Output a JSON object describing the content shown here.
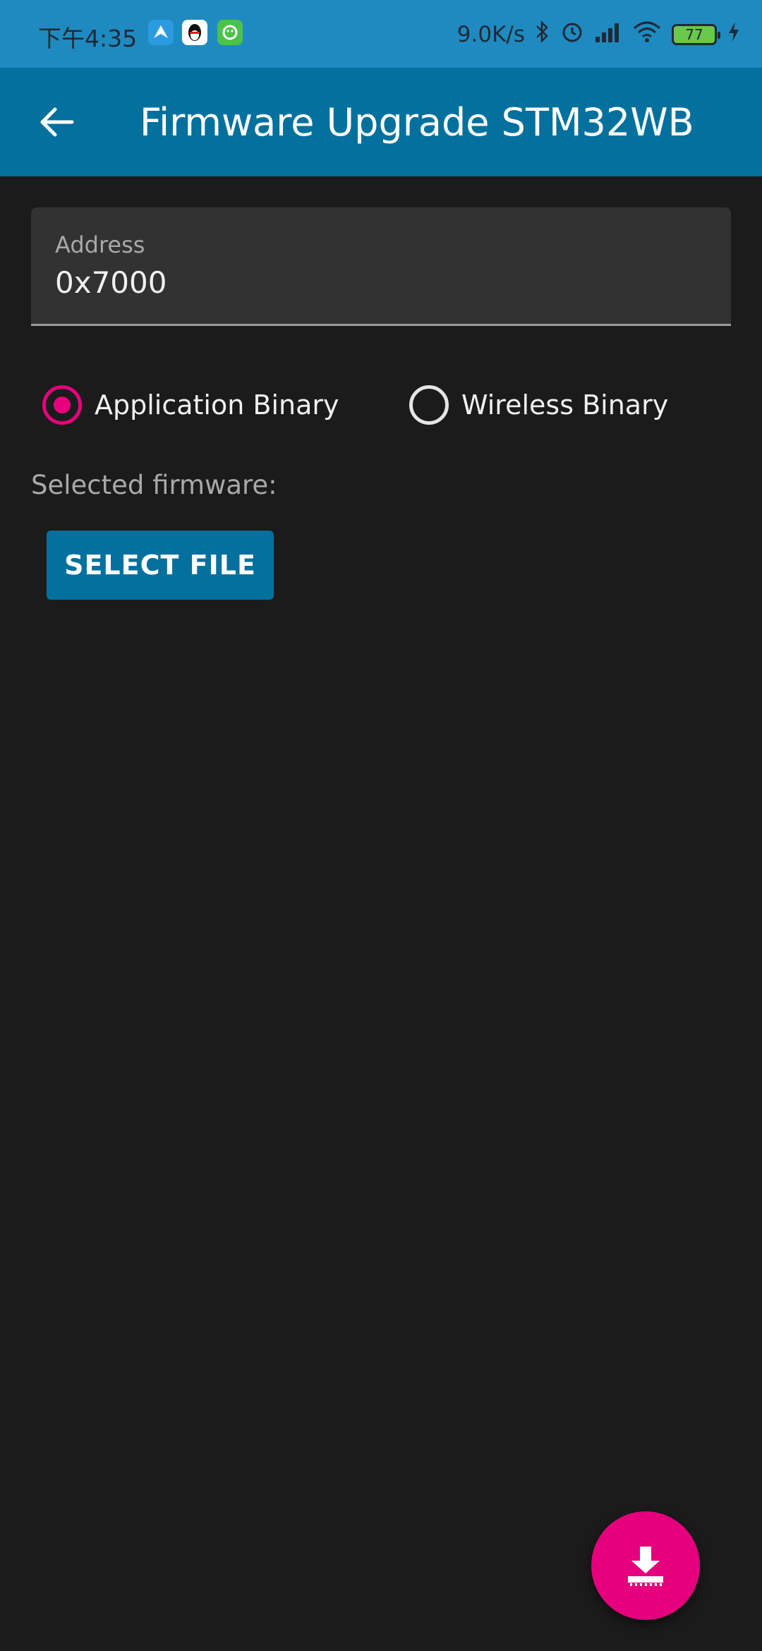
{
  "status_bar": {
    "time": "下午4:35",
    "network_speed": "9.0K/s",
    "battery": "77",
    "icons": [
      "app-bird-icon",
      "qq-icon",
      "wechat-icon",
      "bluetooth-icon",
      "alarm-icon",
      "signal-icon",
      "wifi-icon",
      "battery-icon",
      "charging-icon"
    ]
  },
  "app_bar": {
    "title": "Firmware Upgrade STM32WB",
    "back_icon": "arrow-left-icon"
  },
  "address_field": {
    "label": "Address",
    "value": "0x7000"
  },
  "binary_type": {
    "options": [
      {
        "label": "Application Binary",
        "selected": true
      },
      {
        "label": "Wireless Binary",
        "selected": false
      }
    ]
  },
  "selected_firmware_label": "Selected firmware:",
  "select_file_button": "SELECT FILE",
  "fab": {
    "icon": "download-chip-icon"
  },
  "colors": {
    "status_bar": "#1f8ac0",
    "app_bar": "#03709d",
    "accent": "#e6007e",
    "background": "#1b1b1b"
  }
}
